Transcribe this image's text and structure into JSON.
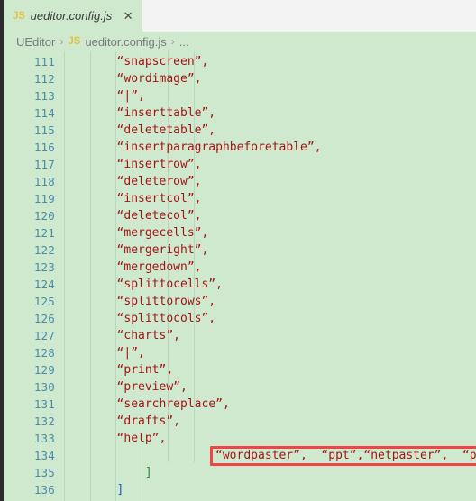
{
  "window": {
    "background": "#cfe9cf",
    "tabbar_background": "#f3f3f3"
  },
  "tab": {
    "icon": "js-file-icon",
    "icon_label": "JS",
    "title": "ueditor.config.js",
    "close_label": "✕"
  },
  "breadcrumb": {
    "root": "UEditor",
    "sep1": "›",
    "icon_label": "JS",
    "file": "ueditor.config.js",
    "sep2": "›",
    "more": "..."
  },
  "editor": {
    "string_color": "#a31515",
    "lineno_color": "#4c8ba6",
    "indent_guide_color": "#bcd6bc",
    "first_line": 111,
    "line_height": 19,
    "lines": [
      {
        "no": "111",
        "text": "“snapscreen”,",
        "indent": 8,
        "kind": "str"
      },
      {
        "no": "112",
        "text": "“wordimage”,",
        "indent": 8,
        "kind": "str"
      },
      {
        "no": "113",
        "text": "“|”,",
        "indent": 8,
        "kind": "str"
      },
      {
        "no": "114",
        "text": "“inserttable”,",
        "indent": 8,
        "kind": "str"
      },
      {
        "no": "115",
        "text": "“deletetable”,",
        "indent": 8,
        "kind": "str"
      },
      {
        "no": "116",
        "text": "“insertparagraphbeforetable”,",
        "indent": 8,
        "kind": "str"
      },
      {
        "no": "117",
        "text": "“insertrow”,",
        "indent": 8,
        "kind": "str"
      },
      {
        "no": "118",
        "text": "“deleterow”,",
        "indent": 8,
        "kind": "str"
      },
      {
        "no": "119",
        "text": "“insertcol”,",
        "indent": 8,
        "kind": "str"
      },
      {
        "no": "120",
        "text": "“deletecol”,",
        "indent": 8,
        "kind": "str"
      },
      {
        "no": "121",
        "text": "“mergecells”,",
        "indent": 8,
        "kind": "str"
      },
      {
        "no": "122",
        "text": "“mergeright”,",
        "indent": 8,
        "kind": "str"
      },
      {
        "no": "123",
        "text": "“mergedown”,",
        "indent": 8,
        "kind": "str"
      },
      {
        "no": "124",
        "text": "“splittocells”,",
        "indent": 8,
        "kind": "str"
      },
      {
        "no": "125",
        "text": "“splittorows”,",
        "indent": 8,
        "kind": "str"
      },
      {
        "no": "126",
        "text": "“splittocols”,",
        "indent": 8,
        "kind": "str"
      },
      {
        "no": "127",
        "text": "“charts”,",
        "indent": 8,
        "kind": "str"
      },
      {
        "no": "128",
        "text": "“|”,",
        "indent": 8,
        "kind": "str"
      },
      {
        "no": "129",
        "text": "“print”,",
        "indent": 8,
        "kind": "str"
      },
      {
        "no": "130",
        "text": "“preview”,",
        "indent": 8,
        "kind": "str"
      },
      {
        "no": "131",
        "text": "“searchreplace”,",
        "indent": 8,
        "kind": "str"
      },
      {
        "no": "132",
        "text": "“drafts”,",
        "indent": 8,
        "kind": "str"
      },
      {
        "no": "133",
        "text": "“help”,",
        "indent": 8,
        "kind": "str"
      },
      {
        "no": "134",
        "text": "“wordpaster”,  “ppt”,“netpaster”,  “pdf”",
        "indent": 22,
        "kind": "str"
      },
      {
        "no": "135",
        "text": "]",
        "indent": 12,
        "kind": "br-green"
      },
      {
        "no": "136",
        "text": "]",
        "indent": 8,
        "kind": "br-blue"
      }
    ],
    "indent_guides_x": [
      67,
      96,
      124,
      153
    ],
    "annotation": {
      "type": "red-rectangle",
      "color": "#f24444",
      "target_line": "134",
      "content": "“wordpaster”,  “ppt”,“netpaster”,  “pdf”"
    }
  }
}
